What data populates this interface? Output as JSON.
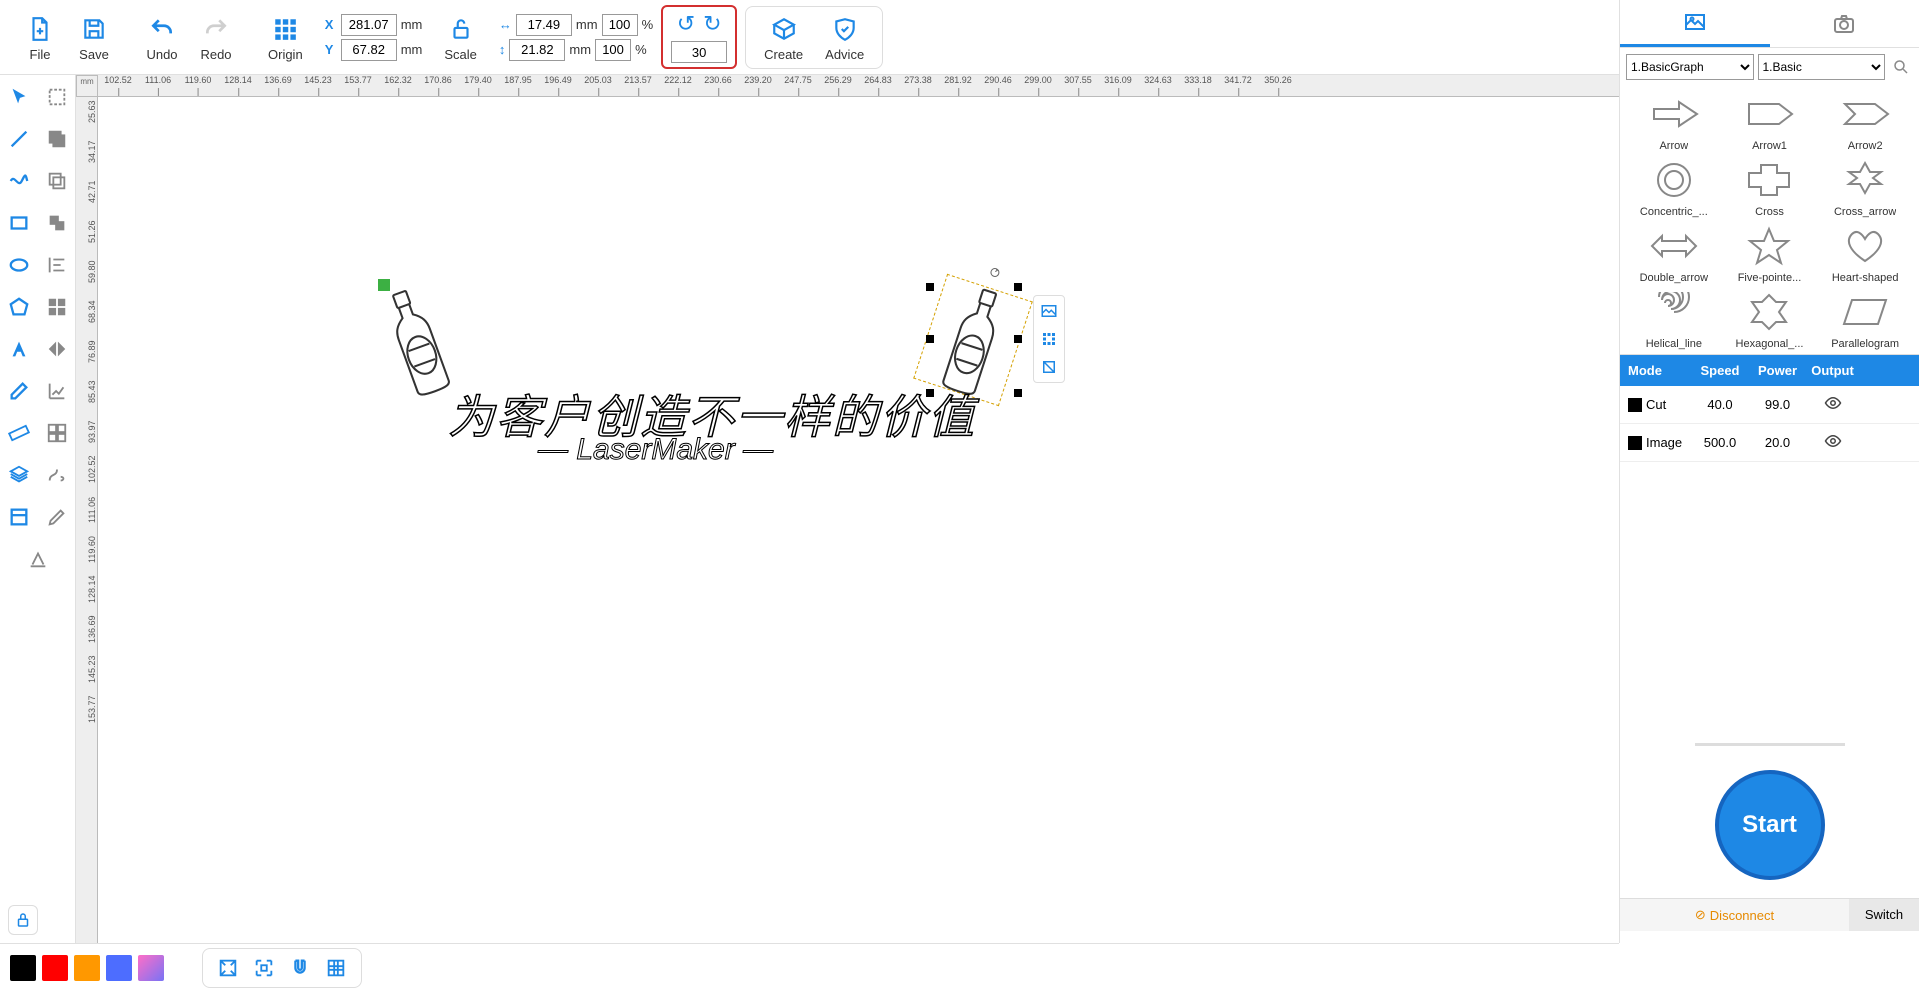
{
  "toolbar": {
    "file_label": "File",
    "save_label": "Save",
    "undo_label": "Undo",
    "redo_label": "Redo",
    "origin_label": "Origin",
    "scale_label": "Scale",
    "create_label": "Create",
    "advice_label": "Advice",
    "x_label": "X",
    "y_label": "Y",
    "x_value": "281.07",
    "y_value": "67.82",
    "mm": "mm",
    "w_value": "17.49",
    "h_value": "21.82",
    "pct": "%",
    "pct_w": "100",
    "pct_h": "100",
    "rotate_value": "30"
  },
  "ruler_unit": "mm",
  "ruler_h": [
    "102.52",
    "111.06",
    "119.60",
    "128.14",
    "136.69",
    "145.23",
    "153.77",
    "162.32",
    "170.86",
    "179.40",
    "187.95",
    "196.49",
    "205.03",
    "213.57",
    "222.12",
    "230.66",
    "239.20",
    "247.75",
    "256.29",
    "264.83",
    "273.38",
    "281.92",
    "290.46",
    "299.00",
    "307.55",
    "316.09",
    "324.63",
    "333.18",
    "341.72",
    "350.26"
  ],
  "ruler_v": [
    "25.63",
    "34.17",
    "42.71",
    "51.26",
    "59.80",
    "68.34",
    "76.89",
    "85.43",
    "93.97",
    "102.52",
    "111.06",
    "119.60",
    "128.14",
    "136.69",
    "145.23",
    "153.77"
  ],
  "canvas": {
    "text_cn": "为客户创造不一样的价值",
    "text_en": "— LaserMaker —"
  },
  "shapes": {
    "select1": "1.BasicGraph",
    "select2": "1.Basic",
    "items": [
      {
        "label": "Arrow"
      },
      {
        "label": "Arrow1"
      },
      {
        "label": "Arrow2"
      },
      {
        "label": "Concentric_..."
      },
      {
        "label": "Cross"
      },
      {
        "label": "Cross_arrow"
      },
      {
        "label": "Double_arrow"
      },
      {
        "label": "Five-pointe..."
      },
      {
        "label": "Heart-shaped"
      },
      {
        "label": "Helical_line"
      },
      {
        "label": "Hexagonal_..."
      },
      {
        "label": "Parallelogram"
      }
    ]
  },
  "layers": {
    "head": {
      "mode": "Mode",
      "speed": "Speed",
      "power": "Power",
      "output": "Output"
    },
    "rows": [
      {
        "mode": "Cut",
        "speed": "40.0",
        "power": "99.0"
      },
      {
        "mode": "Image",
        "speed": "500.0",
        "power": "20.0"
      }
    ]
  },
  "start_label": "Start",
  "disconnect_label": "Disconnect",
  "switch_label": "Switch",
  "colors": [
    "#000000",
    "#ff0000",
    "#ff9800",
    "#4d6dff",
    "#ff66cc"
  ]
}
